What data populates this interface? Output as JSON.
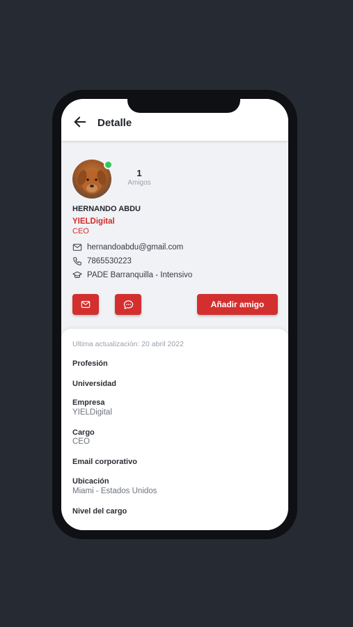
{
  "header": {
    "title": "Detalle"
  },
  "profile": {
    "friends_count": "1",
    "friends_label": "Amigos",
    "name": "HERNANDO ABDU",
    "company": "YIELDigital",
    "role": "CEO",
    "email": "hernandoabdu@gmail.com",
    "phone": "7865530223",
    "program": "PADE Barranquilla - Intensivo"
  },
  "actions": {
    "add_friend_label": "Añadir amigo"
  },
  "details": {
    "last_updated": "Ultima actualización: 20 abril 2022",
    "profession_label": "Profesión",
    "university_label": "Universidad",
    "company_label": "Empresa",
    "company_value": "YIELDigital",
    "position_label": "Cargo",
    "position_value": "CEO",
    "corporate_email_label": "Email corporativo",
    "location_label": "Ubicación",
    "location_value": "Miami - Estados Unidos",
    "position_level_label": "Nivel del cargo"
  },
  "colors": {
    "accent": "#d32f2f",
    "online": "#34c759",
    "background": "#262a33"
  },
  "icons": [
    "back-arrow-icon",
    "mail-icon",
    "phone-icon",
    "graduation-cap-icon",
    "chat-icon"
  ]
}
